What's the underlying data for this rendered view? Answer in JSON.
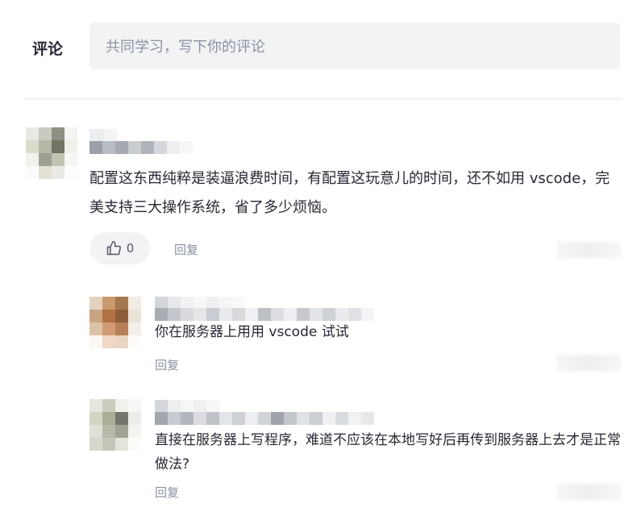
{
  "header": {
    "title": "评论"
  },
  "comment_box": {
    "placeholder": "共同学习，写下你的评论"
  },
  "comments": [
    {
      "content": "配置这东西纯粹是装逼浪费时间，有配置这玩意儿的时间，还不如用 vscode，完美支持三大操作系统，省了多少烦恼。",
      "likes": "0",
      "reply_label": "回复",
      "replies": [
        {
          "content": "你在服务器上用用 vscode 试试",
          "reply_label": "回复"
        },
        {
          "content": "直接在服务器上写程序，难道不应该在本地写好后再传到服务器上去才是正常做法?",
          "reply_label": "回复"
        }
      ]
    }
  ],
  "icons": {
    "like": "thumbs-up-icon"
  }
}
